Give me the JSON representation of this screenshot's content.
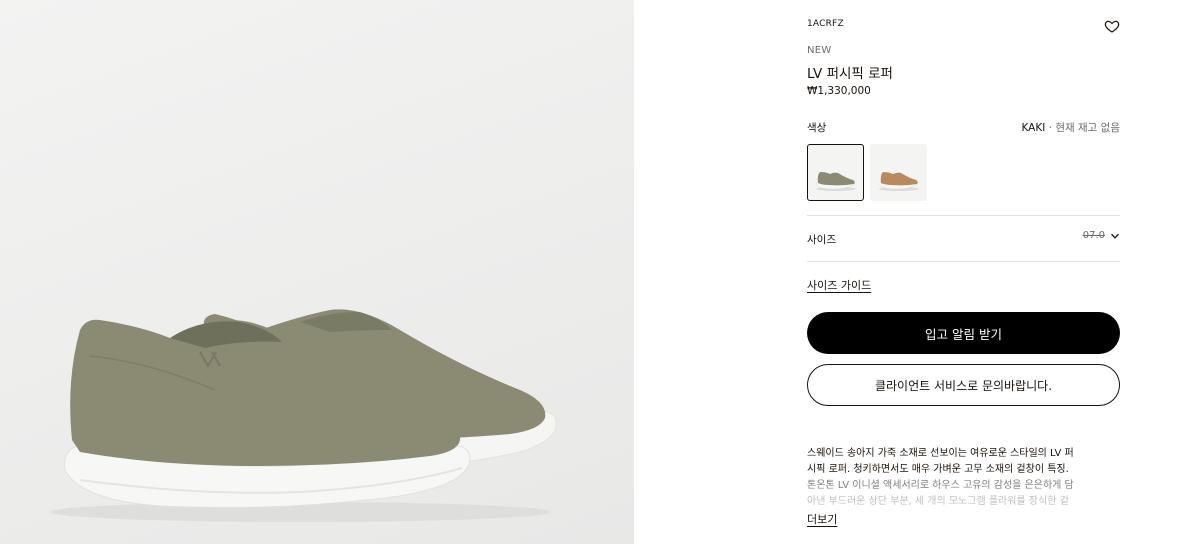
{
  "product": {
    "sku": "1ACRFZ",
    "badge": "NEW",
    "title": "LV 퍼시픽 로퍼",
    "price": "₩1,330,000",
    "image_icon": "shoe-image"
  },
  "color": {
    "label": "색상",
    "selected_name": "KAKI",
    "stock_status": " · 현재 재고 없음",
    "options": [
      {
        "name": "khaki-loafer",
        "color": "#8a8b72"
      },
      {
        "name": "camel-loafer",
        "color": "#b98a5e"
      }
    ]
  },
  "size": {
    "label": "사이즈",
    "selected": "07.0",
    "icon": "chevron-down-icon"
  },
  "links": {
    "size_guide": "사이즈 가이드",
    "more": "더보기"
  },
  "buttons": {
    "notify": "입고 알림 받기",
    "contact": "클라이언트 서비스로 문의바랍니다."
  },
  "description": {
    "lines": [
      "스웨이드 송아지 가죽 소재로 선보이는 여유로운 스타일의 LV 퍼",
      "시픽 로퍼. 청키하면서도 매우 가벼운 고무 소재의 겉창이 특징.",
      "톤온톤 LV 이니셜 액세서리로 하우스 고유의 감성을 은은하게 담",
      "아낸 부드러운 상단 부분, 세 개의 모노그램 플라워를 장식한 겉"
    ]
  },
  "colors": {
    "text": "#19110b",
    "muted": "#6f6a66",
    "divider": "#e3e1dd",
    "button_primary": "#000000",
    "suede_khaki": "#8a8b72",
    "sole_white": "#f7f7f5"
  }
}
